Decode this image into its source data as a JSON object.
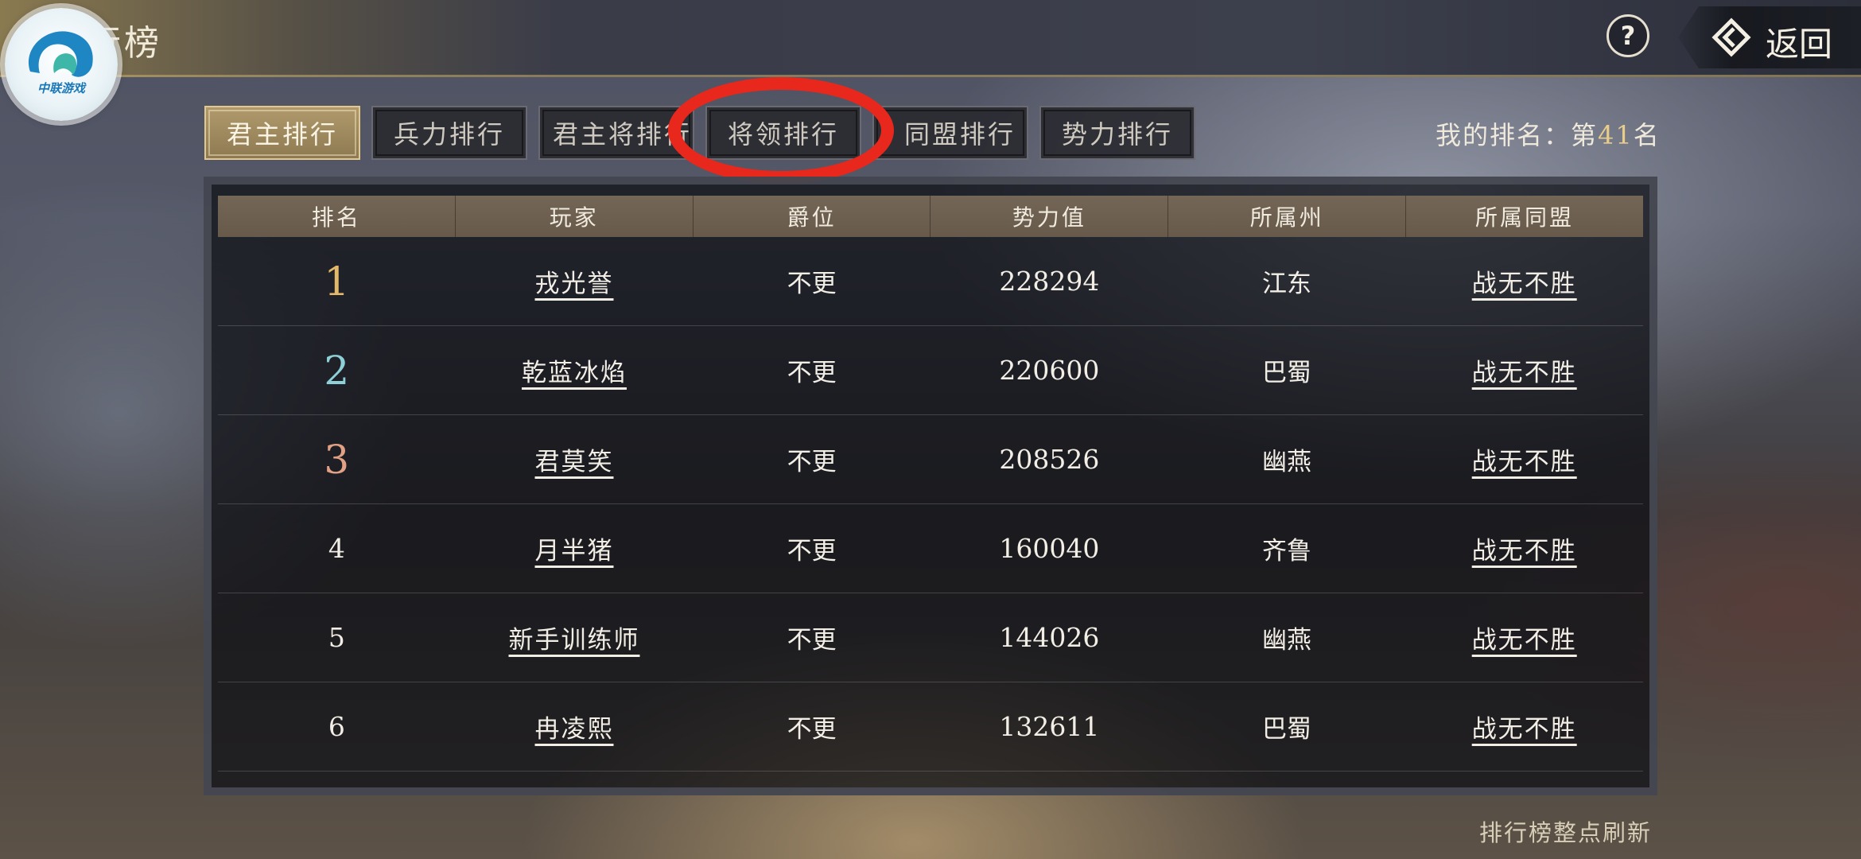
{
  "header": {
    "title": "行榜",
    "logo_text": "中联游戏",
    "help_label": "?",
    "back_label": "返回"
  },
  "tabs": [
    {
      "label": "君主排行",
      "active": true
    },
    {
      "label": "兵力排行",
      "active": false
    },
    {
      "label": "君主将排行",
      "active": false
    },
    {
      "label": "将领排行",
      "active": false
    },
    {
      "label": "同盟排行",
      "active": false
    },
    {
      "label": "势力排行",
      "active": false
    }
  ],
  "my_rank": {
    "prefix": "我的排名：第",
    "value": "41",
    "suffix": "名"
  },
  "table": {
    "columns": [
      "排名",
      "玩家",
      "爵位",
      "势力值",
      "所属州",
      "所属同盟"
    ],
    "rows": [
      {
        "rank": "1",
        "player": "戎光誉",
        "title": "不更",
        "power": "228294",
        "state": "江东",
        "alliance": "战无不胜"
      },
      {
        "rank": "2",
        "player": "乾蓝冰焰",
        "title": "不更",
        "power": "220600",
        "state": "巴蜀",
        "alliance": "战无不胜"
      },
      {
        "rank": "3",
        "player": "君莫笑",
        "title": "不更",
        "power": "208526",
        "state": "幽燕",
        "alliance": "战无不胜"
      },
      {
        "rank": "4",
        "player": "月半猪",
        "title": "不更",
        "power": "160040",
        "state": "齐鲁",
        "alliance": "战无不胜"
      },
      {
        "rank": "5",
        "player": "新手训练师",
        "title": "不更",
        "power": "144026",
        "state": "幽燕",
        "alliance": "战无不胜"
      },
      {
        "rank": "6",
        "player": "冉凌熙",
        "title": "不更",
        "power": "132611",
        "state": "巴蜀",
        "alliance": "战无不胜"
      }
    ]
  },
  "footer": {
    "refresh_note": "排行榜整点刷新"
  },
  "colors": {
    "accent_gold": "#e7cc8a",
    "annotation_red": "#e8281c",
    "rank1": "#e4b86a",
    "rank2": "#8ed0d8",
    "rank3": "#e2a184"
  }
}
